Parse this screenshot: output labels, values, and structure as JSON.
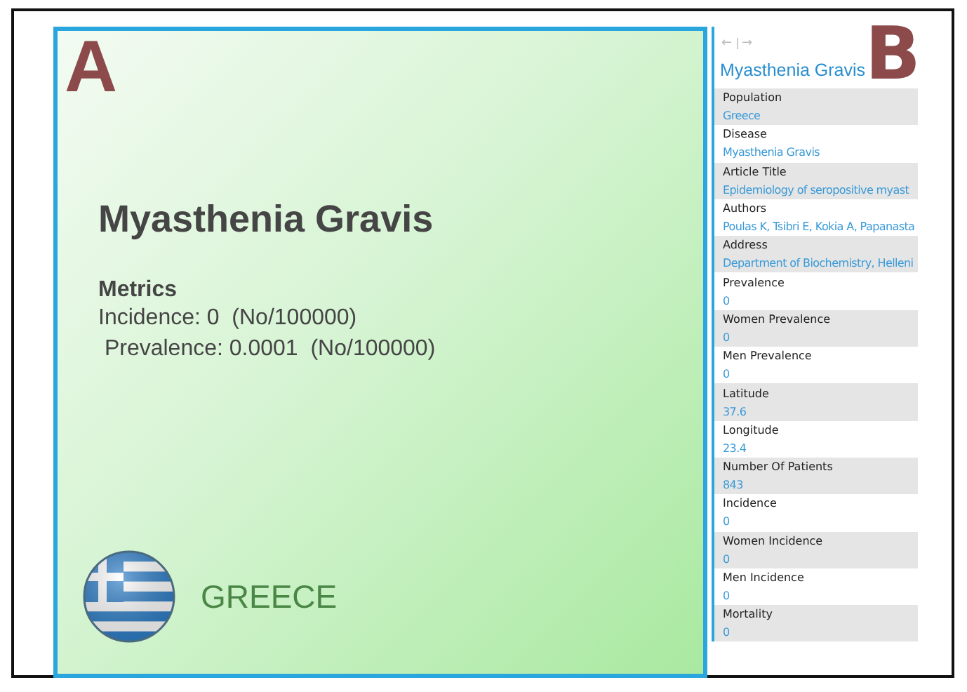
{
  "panel_a": {
    "label": "A",
    "title": "Myasthenia Gravis",
    "metrics_heading": "Metrics",
    "metrics": [
      "Incidence: 0  (No/100000)",
      " Prevalence: 0.0001  (No/100000)"
    ],
    "country": "GREECE"
  },
  "panel_b": {
    "label": "B",
    "nav": {
      "back": "←",
      "forward": "→"
    },
    "title": "Myasthenia Gravis",
    "fields": [
      {
        "label": "Population",
        "value": "Greece"
      },
      {
        "label": "Disease",
        "value": "Myasthenia Gravis"
      },
      {
        "label": "Article Title",
        "value": "Epidemiology of seropositive myast"
      },
      {
        "label": "Authors",
        "value": "Poulas K, Tsibri E, Kokia A, Papanasta"
      },
      {
        "label": "Address",
        "value": "Department of Biochemistry, Helleni"
      },
      {
        "label": "Prevalence",
        "value": "0"
      },
      {
        "label": "Women Prevalence",
        "value": "0"
      },
      {
        "label": "Men Prevalence",
        "value": "0"
      },
      {
        "label": "Latitude",
        "value": "37.6"
      },
      {
        "label": "Longitude",
        "value": "23.4"
      },
      {
        "label": "Number Of Patients",
        "value": "843"
      },
      {
        "label": "Incidence",
        "value": "0"
      },
      {
        "label": "Women Incidence",
        "value": "0"
      },
      {
        "label": "Men Incidence",
        "value": "0"
      },
      {
        "label": "Mortality",
        "value": "0"
      }
    ]
  }
}
